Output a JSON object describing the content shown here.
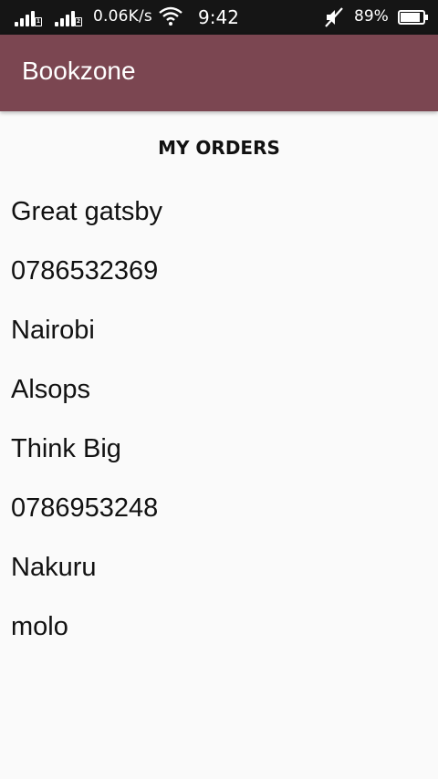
{
  "status_bar": {
    "network_speed": "0.06K/s",
    "time": "9:42",
    "battery_percent": "89%",
    "sim1_label": "1",
    "sim2_label": "2",
    "battery_level": 0.89
  },
  "app_bar": {
    "title": "Bookzone",
    "color": "#7b4651"
  },
  "main": {
    "heading": "MY ORDERS",
    "order_lines": [
      "Great gatsby",
      "0786532369",
      "Nairobi",
      "Alsops",
      "Think Big",
      "0786953248",
      "Nakuru",
      "molo"
    ]
  },
  "icons": [
    "signal-icon",
    "wifi-icon",
    "mute-icon",
    "battery-icon"
  ]
}
